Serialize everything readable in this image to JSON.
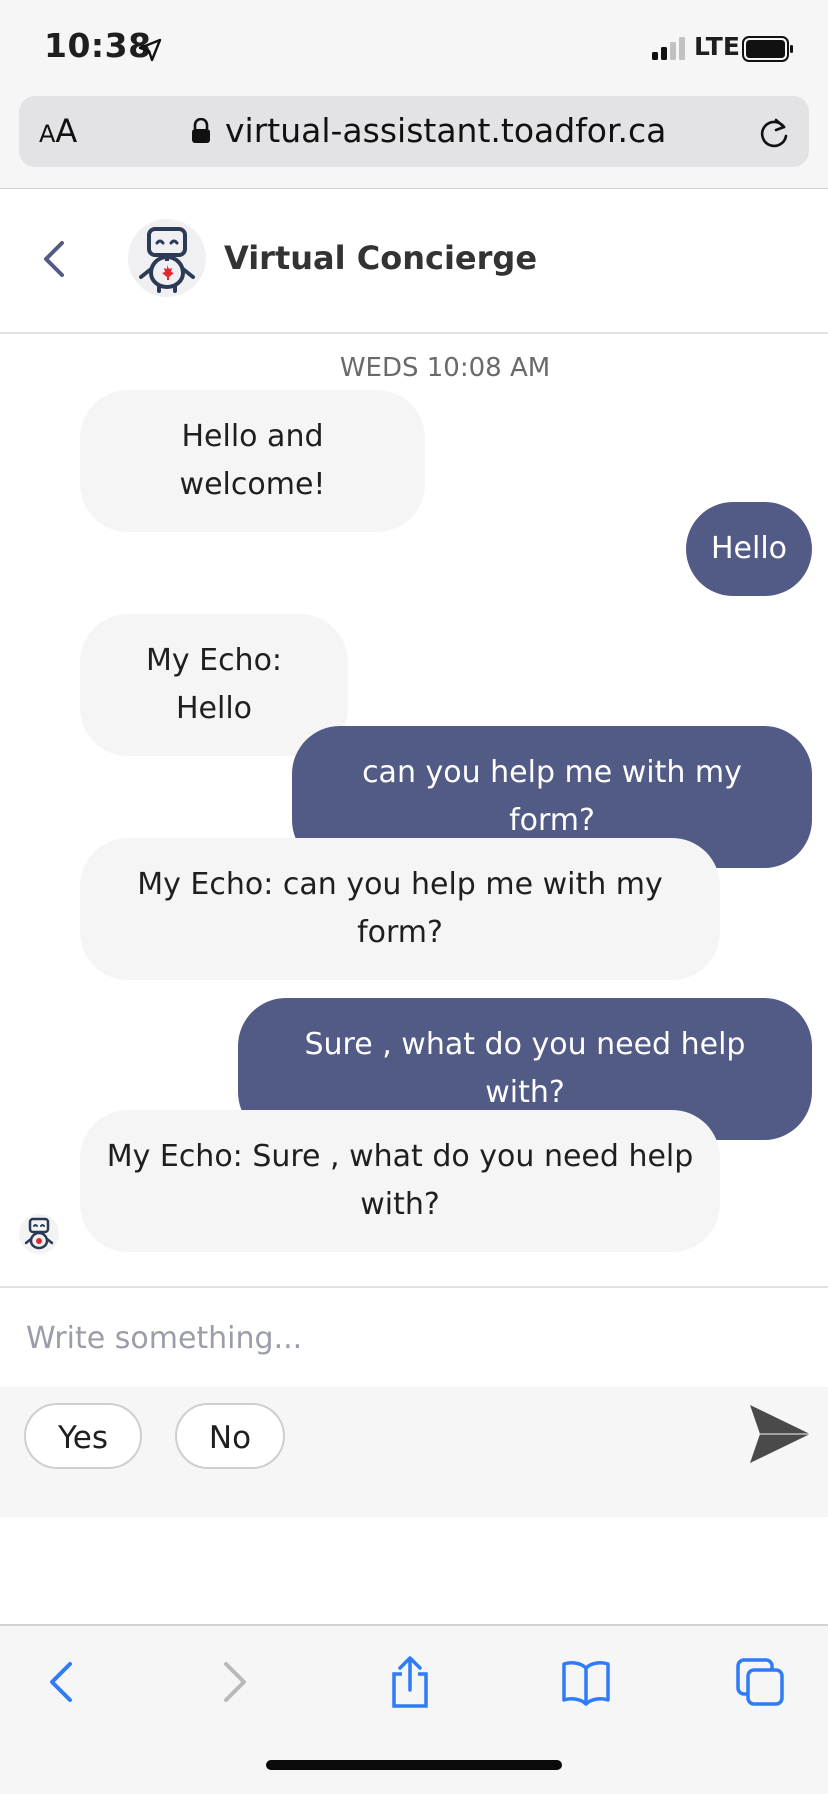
{
  "status_bar": {
    "time": "10:38",
    "network": "LTE"
  },
  "browser": {
    "text_size_label": "AA",
    "url": "virtual-assistant.toadfor.ca"
  },
  "chat": {
    "title": "Virtual Concierge",
    "timestamp": "WEDS 10:08 AM",
    "messages": [
      {
        "sender": "bot",
        "text": "Hello and welcome!"
      },
      {
        "sender": "user",
        "text": "Hello"
      },
      {
        "sender": "bot",
        "text": "My Echo: Hello"
      },
      {
        "sender": "user",
        "text": "can you help me with my form?"
      },
      {
        "sender": "bot",
        "text": "My Echo: can you help me with my form?"
      },
      {
        "sender": "user",
        "text": "Sure , what do you need help with?"
      },
      {
        "sender": "bot",
        "text": "My Echo: Sure , what do you need help with?"
      }
    ],
    "input_placeholder": "Write something...",
    "quick_replies": [
      "Yes",
      "No"
    ]
  },
  "colors": {
    "user_bubble": "#525a86",
    "bot_bubble": "#f5f5f5",
    "accent": "#2f7cf6",
    "avatar_maple": "#e0282e"
  },
  "icons": [
    "location-arrow-icon",
    "lock-icon",
    "reload-icon",
    "back-chevron-icon",
    "robot-avatar-icon",
    "send-icon",
    "browser-back-icon",
    "browser-forward-icon",
    "share-icon",
    "bookmarks-icon",
    "tabs-icon"
  ]
}
